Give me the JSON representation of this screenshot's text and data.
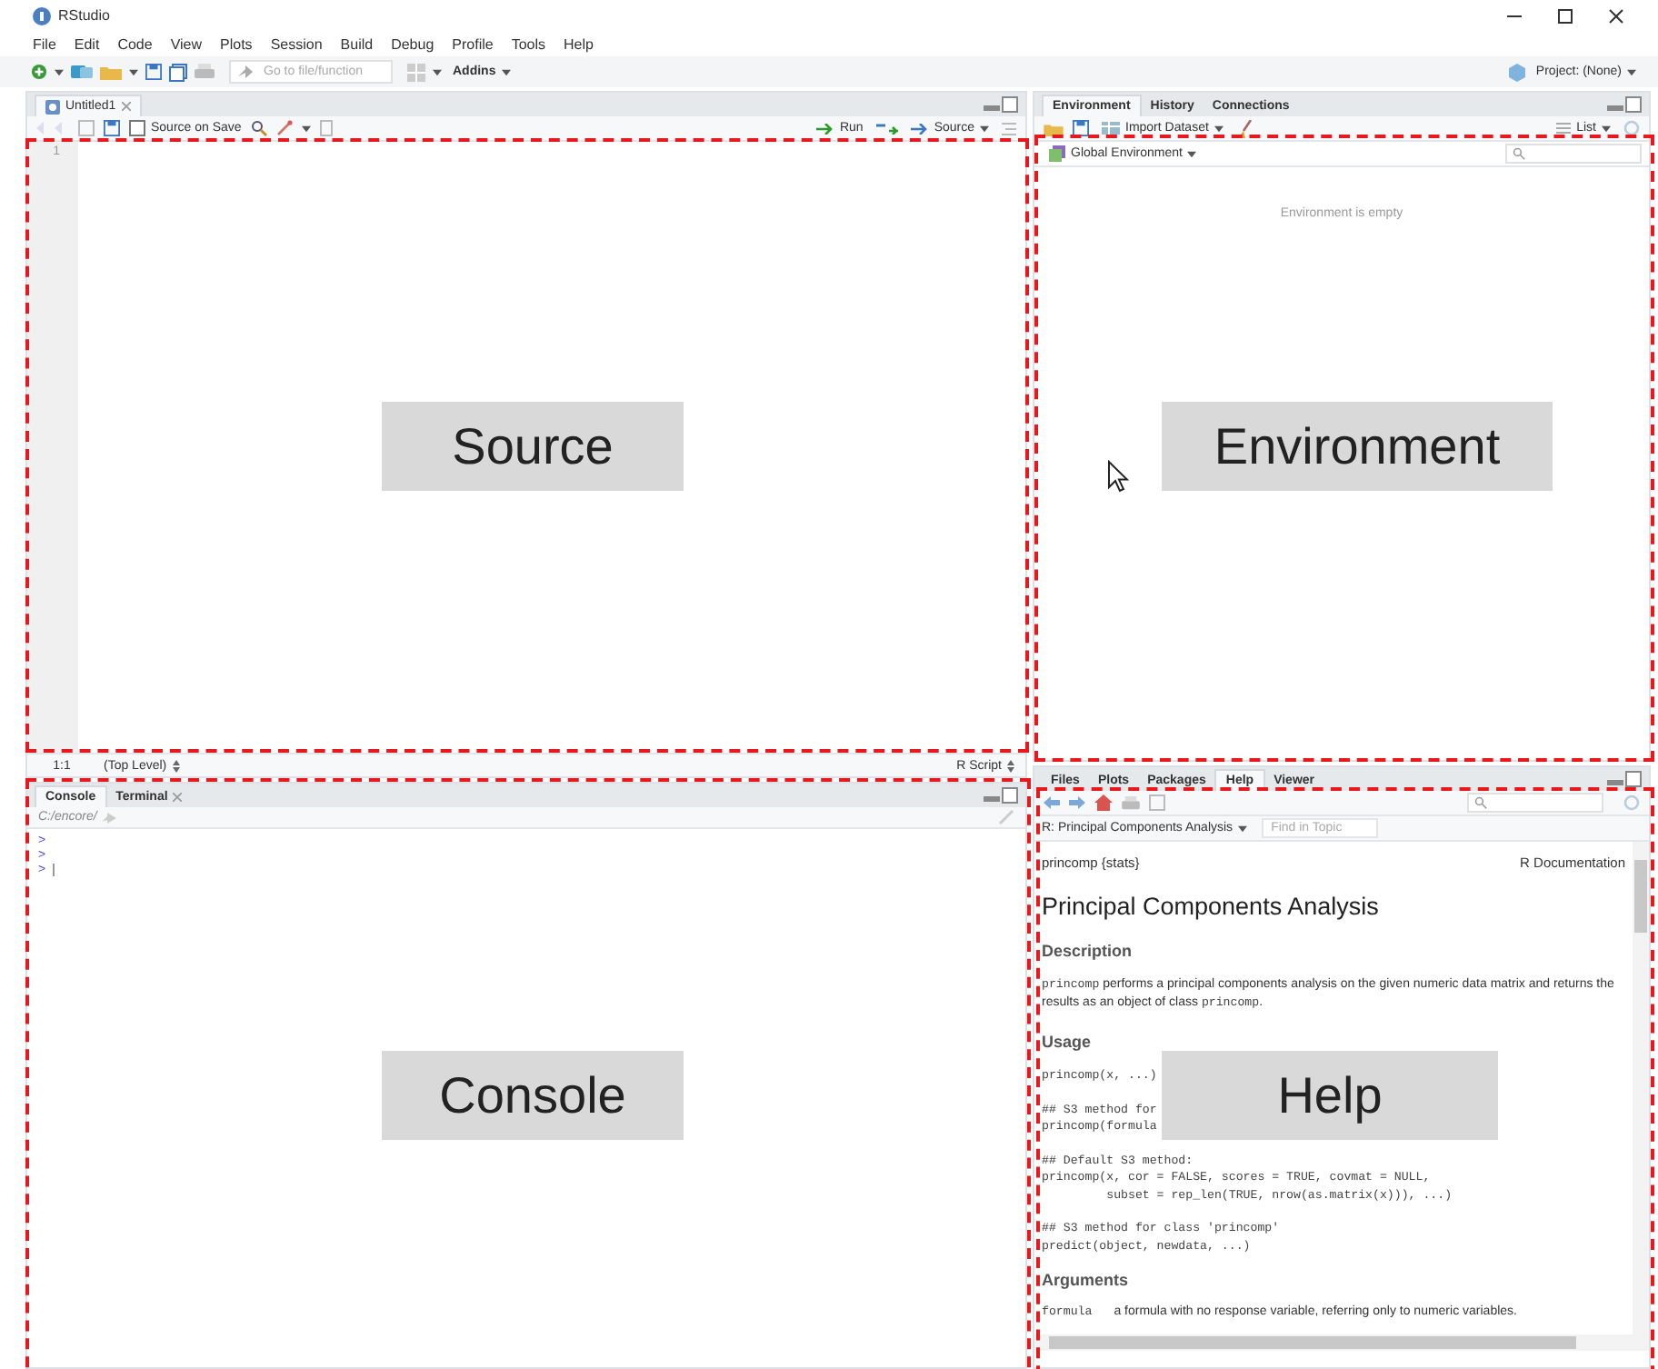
{
  "window": {
    "title": "RStudio"
  },
  "menu": [
    "File",
    "Edit",
    "Code",
    "View",
    "Plots",
    "Session",
    "Build",
    "Debug",
    "Profile",
    "Tools",
    "Help"
  ],
  "toolbar": {
    "goto_placeholder": "Go to file/function",
    "addins": "Addins",
    "project": "Project: (None)"
  },
  "source": {
    "tabs": [
      {
        "label": "Untitled1",
        "selected": true,
        "closable": true
      }
    ],
    "source_on_save": {
      "label": "Source on Save",
      "checked": false
    },
    "run": "Run",
    "source_button": "Source",
    "line_numbers": [
      "1"
    ],
    "cursor_pos": "1:1",
    "scope": "(Top Level)",
    "file_type": "R Script",
    "callout": "Source"
  },
  "console": {
    "tabs": [
      {
        "label": "Console",
        "selected": true,
        "closable": false
      },
      {
        "label": "Terminal",
        "selected": false,
        "closable": true
      }
    ],
    "path": "C:/encore/",
    "prompts": [
      ">",
      ">",
      ">"
    ],
    "callout": "Console"
  },
  "environment": {
    "tabs": [
      {
        "label": "Environment",
        "selected": true
      },
      {
        "label": "History",
        "selected": false
      },
      {
        "label": "Connections",
        "selected": false
      }
    ],
    "import": "Import Dataset",
    "view": "List",
    "scope": "Global Environment",
    "message": "Environment is empty",
    "callout": "Environment"
  },
  "help_pane": {
    "tabs": [
      {
        "label": "Files",
        "selected": false
      },
      {
        "label": "Plots",
        "selected": false
      },
      {
        "label": "Packages",
        "selected": false
      },
      {
        "label": "Help",
        "selected": true
      },
      {
        "label": "Viewer",
        "selected": false
      }
    ],
    "topic": "R: Principal Components Analysis",
    "find_placeholder": "Find in Topic",
    "package": "princomp {stats}",
    "doc_source": "R Documentation",
    "title": "Principal Components Analysis",
    "callout": "Help",
    "blocks": [
      {
        "kind": "heading",
        "text": "Description"
      },
      {
        "kind": "para",
        "parts": [
          {
            "text": "princomp",
            "code": true
          },
          {
            "text": " performs a principal components analysis on the given numeric data matrix and returns the results as an object of class ",
            "code": false
          },
          {
            "text": "princomp",
            "code": true
          },
          {
            "text": ".",
            "code": false
          }
        ]
      },
      {
        "kind": "heading",
        "text": "Usage"
      },
      {
        "kind": "code",
        "lines": [
          "princomp(x, ...)"
        ]
      },
      {
        "kind": "code",
        "lines": [
          "## S3 method for",
          "princomp(formula"
        ]
      },
      {
        "kind": "code",
        "lines": [
          "## Default S3 method:",
          "princomp(x, cor = FALSE, scores = TRUE, covmat = NULL,",
          "         subset = rep_len(TRUE, nrow(as.matrix(x))), ...)"
        ]
      },
      {
        "kind": "code",
        "lines": [
          "## S3 method for class 'princomp'",
          "predict(object, newdata, ...)"
        ]
      },
      {
        "kind": "heading",
        "text": "Arguments"
      },
      {
        "kind": "arg",
        "name": "formula",
        "text": "a formula with no response variable, referring only to numeric variables."
      }
    ]
  }
}
